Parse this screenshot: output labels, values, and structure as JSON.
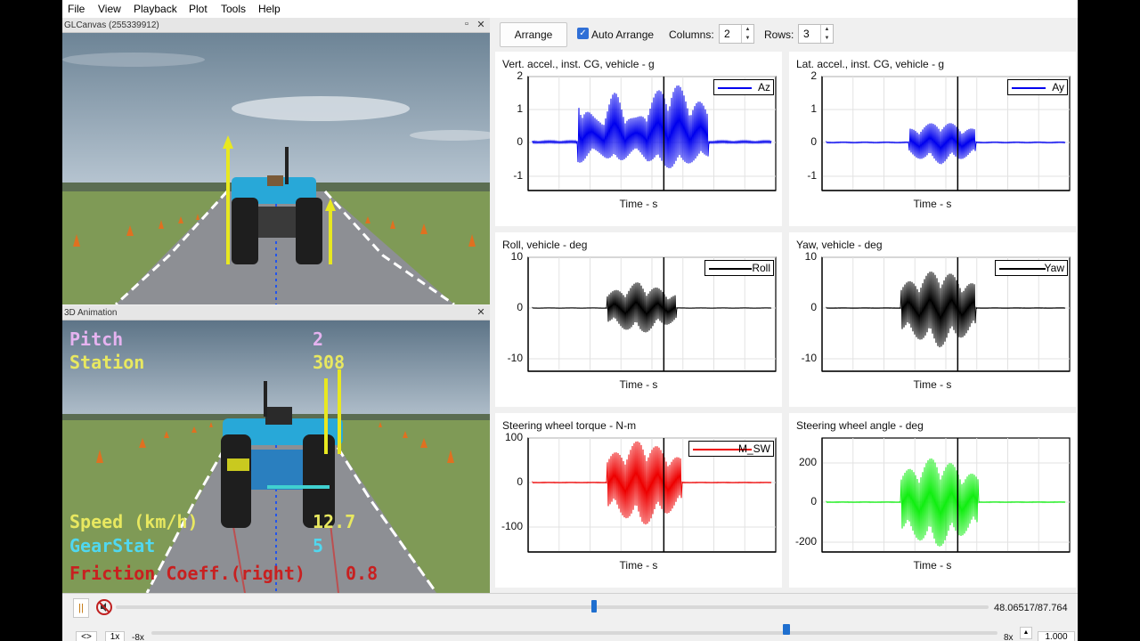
{
  "menu": [
    "File",
    "View",
    "Playback",
    "Plot",
    "Tools",
    "Help"
  ],
  "top_pane": {
    "title": "GLCanvas (255339912)"
  },
  "anim_pane": {
    "title": "3D Animation",
    "hud": {
      "pitch_label": "Pitch",
      "pitch_value": "2",
      "station_label": "Station",
      "station_value": "308",
      "speed_label": "Speed (km/h)",
      "speed_value": "12.7",
      "gear_label": "GearStat",
      "gear_value": "5",
      "friction_label": "Friction Coeff.(right)",
      "friction_value": "0.8"
    }
  },
  "toolbar": {
    "arrange_label": "Arrange",
    "auto_arrange_label": "Auto Arrange",
    "columns_label": "Columns:",
    "columns_value": "2",
    "rows_label": "Rows:",
    "rows_value": "3"
  },
  "plots": [
    {
      "title": "Vert. accel., inst. CG, vehicle - g",
      "xlabel": "Time - s",
      "legend": "Az",
      "color": "#0000ee",
      "yticks": [
        "2",
        "1",
        "0",
        "-1"
      ]
    },
    {
      "title": "Lat. accel., inst. CG, vehicle - g",
      "xlabel": "Time - s",
      "legend": "Ay",
      "color": "#0000ee",
      "yticks": [
        "2",
        "1",
        "0",
        "-1"
      ]
    },
    {
      "title": "Roll, vehicle - deg",
      "xlabel": "Time - s",
      "legend": "Roll",
      "color": "#000000",
      "yticks": [
        "10",
        "0",
        "-10"
      ]
    },
    {
      "title": "Yaw, vehicle - deg",
      "xlabel": "Time - s",
      "legend": "Yaw",
      "color": "#000000",
      "yticks": [
        "10",
        "0",
        "-10"
      ]
    },
    {
      "title": "Steering wheel torque - N-m",
      "xlabel": "Time - s",
      "legend": "M_SW",
      "color": "#ee0000",
      "yticks": [
        "100",
        "0",
        "-100"
      ]
    },
    {
      "title": "Steering wheel angle - deg",
      "xlabel": "Time - s",
      "legend": "",
      "color": "#11ee11",
      "yticks": [
        "200",
        "0",
        "-200"
      ]
    }
  ],
  "playback": {
    "time_readout": "48.06517/87.764",
    "progress": 0.548,
    "speed_fraction": 0.75,
    "speed_1x": "1x",
    "speed_neg8x": "-8x",
    "speed_8x": "8x",
    "speed_value": "1.000"
  }
}
